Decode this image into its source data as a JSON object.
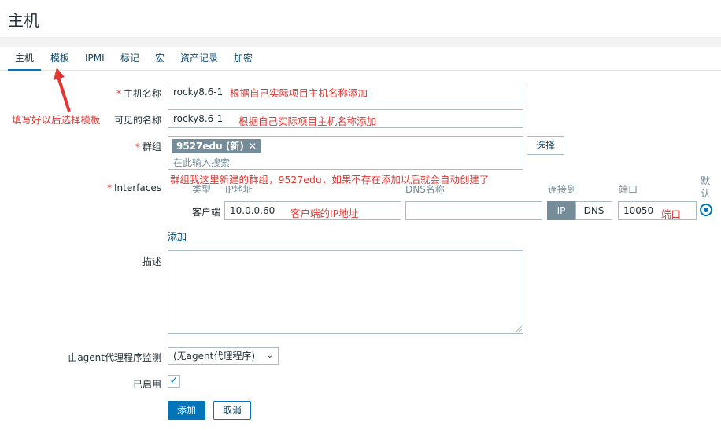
{
  "header": {
    "title": "主机"
  },
  "tabs": [
    {
      "label": "主机"
    },
    {
      "label": "模板"
    },
    {
      "label": "IPMI"
    },
    {
      "label": "标记"
    },
    {
      "label": "宏"
    },
    {
      "label": "资产记录"
    },
    {
      "label": "加密"
    }
  ],
  "form": {
    "host_name": {
      "label": "主机名称",
      "value": "rocky8.6-1"
    },
    "visible_name": {
      "label": "可见的名称",
      "value": "rocky8.6-1"
    },
    "groups": {
      "label": "群组",
      "chip": "9527edu (新)",
      "placeholder": "在此输入搜索",
      "select_button": "选择"
    },
    "interfaces": {
      "label": "Interfaces",
      "headers": {
        "type": "类型",
        "ip": "IP地址",
        "dns": "DNS名称",
        "connect_to": "连接到",
        "port": "端口",
        "default": "默认"
      },
      "row": {
        "type": "客户端",
        "ip": "10.0.0.60",
        "dns": "",
        "ip_btn": "IP",
        "dns_btn": "DNS",
        "port": "10050"
      },
      "add_link": "添加"
    },
    "description": {
      "label": "描述",
      "value": ""
    },
    "proxy": {
      "label": "由agent代理程序监测",
      "selected": "(无agent代理程序)"
    },
    "enabled": {
      "label": "已启用",
      "checked": true
    },
    "buttons": {
      "add": "添加",
      "cancel": "取消"
    }
  },
  "annotations": {
    "host_name_note": "根据自己实际项目主机名称添加",
    "visible_name_note": "根据自己实际项目主机名称添加",
    "template_note": "填写好以后选择模板",
    "group_note": "群组我这里新建的群组，9527edu，如果不存在添加以后就会自动创建了",
    "ip_note": "客户端的IP地址",
    "port_note": "端口"
  },
  "colors": {
    "accent": "#0275b8",
    "annotation": "#e33734"
  }
}
